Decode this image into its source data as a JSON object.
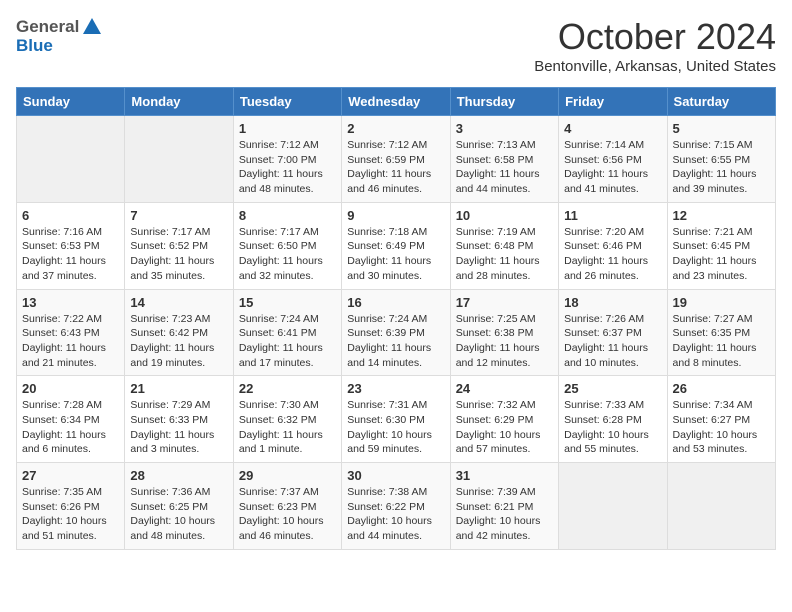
{
  "header": {
    "logo_general": "General",
    "logo_blue": "Blue",
    "title": "October 2024",
    "subtitle": "Bentonville, Arkansas, United States"
  },
  "days_of_week": [
    "Sunday",
    "Monday",
    "Tuesday",
    "Wednesday",
    "Thursday",
    "Friday",
    "Saturday"
  ],
  "weeks": [
    [
      {
        "day": "",
        "empty": true
      },
      {
        "day": "",
        "empty": true
      },
      {
        "day": "1",
        "sunrise": "Sunrise: 7:12 AM",
        "sunset": "Sunset: 7:00 PM",
        "daylight": "Daylight: 11 hours and 48 minutes."
      },
      {
        "day": "2",
        "sunrise": "Sunrise: 7:12 AM",
        "sunset": "Sunset: 6:59 PM",
        "daylight": "Daylight: 11 hours and 46 minutes."
      },
      {
        "day": "3",
        "sunrise": "Sunrise: 7:13 AM",
        "sunset": "Sunset: 6:58 PM",
        "daylight": "Daylight: 11 hours and 44 minutes."
      },
      {
        "day": "4",
        "sunrise": "Sunrise: 7:14 AM",
        "sunset": "Sunset: 6:56 PM",
        "daylight": "Daylight: 11 hours and 41 minutes."
      },
      {
        "day": "5",
        "sunrise": "Sunrise: 7:15 AM",
        "sunset": "Sunset: 6:55 PM",
        "daylight": "Daylight: 11 hours and 39 minutes."
      }
    ],
    [
      {
        "day": "6",
        "sunrise": "Sunrise: 7:16 AM",
        "sunset": "Sunset: 6:53 PM",
        "daylight": "Daylight: 11 hours and 37 minutes."
      },
      {
        "day": "7",
        "sunrise": "Sunrise: 7:17 AM",
        "sunset": "Sunset: 6:52 PM",
        "daylight": "Daylight: 11 hours and 35 minutes."
      },
      {
        "day": "8",
        "sunrise": "Sunrise: 7:17 AM",
        "sunset": "Sunset: 6:50 PM",
        "daylight": "Daylight: 11 hours and 32 minutes."
      },
      {
        "day": "9",
        "sunrise": "Sunrise: 7:18 AM",
        "sunset": "Sunset: 6:49 PM",
        "daylight": "Daylight: 11 hours and 30 minutes."
      },
      {
        "day": "10",
        "sunrise": "Sunrise: 7:19 AM",
        "sunset": "Sunset: 6:48 PM",
        "daylight": "Daylight: 11 hours and 28 minutes."
      },
      {
        "day": "11",
        "sunrise": "Sunrise: 7:20 AM",
        "sunset": "Sunset: 6:46 PM",
        "daylight": "Daylight: 11 hours and 26 minutes."
      },
      {
        "day": "12",
        "sunrise": "Sunrise: 7:21 AM",
        "sunset": "Sunset: 6:45 PM",
        "daylight": "Daylight: 11 hours and 23 minutes."
      }
    ],
    [
      {
        "day": "13",
        "sunrise": "Sunrise: 7:22 AM",
        "sunset": "Sunset: 6:43 PM",
        "daylight": "Daylight: 11 hours and 21 minutes."
      },
      {
        "day": "14",
        "sunrise": "Sunrise: 7:23 AM",
        "sunset": "Sunset: 6:42 PM",
        "daylight": "Daylight: 11 hours and 19 minutes."
      },
      {
        "day": "15",
        "sunrise": "Sunrise: 7:24 AM",
        "sunset": "Sunset: 6:41 PM",
        "daylight": "Daylight: 11 hours and 17 minutes."
      },
      {
        "day": "16",
        "sunrise": "Sunrise: 7:24 AM",
        "sunset": "Sunset: 6:39 PM",
        "daylight": "Daylight: 11 hours and 14 minutes."
      },
      {
        "day": "17",
        "sunrise": "Sunrise: 7:25 AM",
        "sunset": "Sunset: 6:38 PM",
        "daylight": "Daylight: 11 hours and 12 minutes."
      },
      {
        "day": "18",
        "sunrise": "Sunrise: 7:26 AM",
        "sunset": "Sunset: 6:37 PM",
        "daylight": "Daylight: 11 hours and 10 minutes."
      },
      {
        "day": "19",
        "sunrise": "Sunrise: 7:27 AM",
        "sunset": "Sunset: 6:35 PM",
        "daylight": "Daylight: 11 hours and 8 minutes."
      }
    ],
    [
      {
        "day": "20",
        "sunrise": "Sunrise: 7:28 AM",
        "sunset": "Sunset: 6:34 PM",
        "daylight": "Daylight: 11 hours and 6 minutes."
      },
      {
        "day": "21",
        "sunrise": "Sunrise: 7:29 AM",
        "sunset": "Sunset: 6:33 PM",
        "daylight": "Daylight: 11 hours and 3 minutes."
      },
      {
        "day": "22",
        "sunrise": "Sunrise: 7:30 AM",
        "sunset": "Sunset: 6:32 PM",
        "daylight": "Daylight: 11 hours and 1 minute."
      },
      {
        "day": "23",
        "sunrise": "Sunrise: 7:31 AM",
        "sunset": "Sunset: 6:30 PM",
        "daylight": "Daylight: 10 hours and 59 minutes."
      },
      {
        "day": "24",
        "sunrise": "Sunrise: 7:32 AM",
        "sunset": "Sunset: 6:29 PM",
        "daylight": "Daylight: 10 hours and 57 minutes."
      },
      {
        "day": "25",
        "sunrise": "Sunrise: 7:33 AM",
        "sunset": "Sunset: 6:28 PM",
        "daylight": "Daylight: 10 hours and 55 minutes."
      },
      {
        "day": "26",
        "sunrise": "Sunrise: 7:34 AM",
        "sunset": "Sunset: 6:27 PM",
        "daylight": "Daylight: 10 hours and 53 minutes."
      }
    ],
    [
      {
        "day": "27",
        "sunrise": "Sunrise: 7:35 AM",
        "sunset": "Sunset: 6:26 PM",
        "daylight": "Daylight: 10 hours and 51 minutes."
      },
      {
        "day": "28",
        "sunrise": "Sunrise: 7:36 AM",
        "sunset": "Sunset: 6:25 PM",
        "daylight": "Daylight: 10 hours and 48 minutes."
      },
      {
        "day": "29",
        "sunrise": "Sunrise: 7:37 AM",
        "sunset": "Sunset: 6:23 PM",
        "daylight": "Daylight: 10 hours and 46 minutes."
      },
      {
        "day": "30",
        "sunrise": "Sunrise: 7:38 AM",
        "sunset": "Sunset: 6:22 PM",
        "daylight": "Daylight: 10 hours and 44 minutes."
      },
      {
        "day": "31",
        "sunrise": "Sunrise: 7:39 AM",
        "sunset": "Sunset: 6:21 PM",
        "daylight": "Daylight: 10 hours and 42 minutes."
      },
      {
        "day": "",
        "empty": true
      },
      {
        "day": "",
        "empty": true
      }
    ]
  ]
}
